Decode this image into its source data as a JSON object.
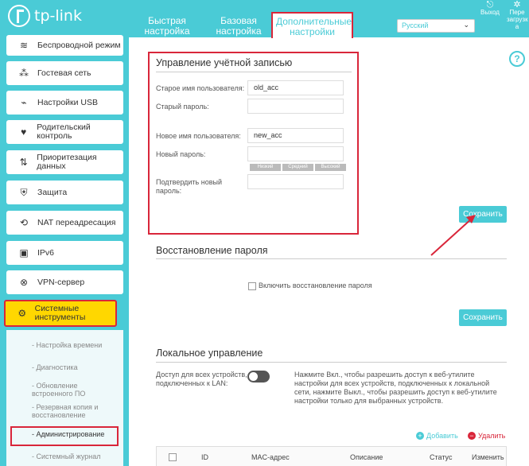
{
  "header": {
    "logo_text": "tp-link",
    "tabs": [
      {
        "label": "Быстрая настройка"
      },
      {
        "label": "Базовая настройка"
      },
      {
        "label": "Дополнительные настройки"
      }
    ],
    "language": "Русский",
    "logout_label": "Выход",
    "reboot_label": "Пере загрузк а"
  },
  "sidebar": {
    "items": [
      {
        "label": "Беспроводной режим",
        "icon": "wifi-icon"
      },
      {
        "label": "Гостевая сеть",
        "icon": "guest-network-icon"
      },
      {
        "label": "Настройки USB",
        "icon": "usb-icon"
      },
      {
        "label": "Родительский контроль",
        "icon": "heart-icon"
      },
      {
        "label": "Приоритезация данных",
        "icon": "priority-arrows-icon"
      },
      {
        "label": "Защита",
        "icon": "shield-icon"
      },
      {
        "label": "NAT переадресация",
        "icon": "nat-icon"
      },
      {
        "label": "IPv6",
        "icon": "ipv6-icon"
      },
      {
        "label": "VPN-сервер",
        "icon": "vpn-icon"
      },
      {
        "label": "Системные инструменты",
        "icon": "gear-icon"
      }
    ],
    "sub_items": [
      {
        "label": "Настройка времени"
      },
      {
        "label": "Диагностика"
      },
      {
        "label": "Обновление встроенного ПО"
      },
      {
        "label": "Резервная копия и восстановление"
      },
      {
        "label": "Администрирование"
      },
      {
        "label": "Системный журнал"
      }
    ]
  },
  "account": {
    "title": "Управление учётной записью",
    "old_username_label": "Старое имя пользователя:",
    "old_username_value": "old_acc",
    "old_password_label": "Старый пароль:",
    "new_username_label": "Новое имя пользователя:",
    "new_username_value": "new_acc",
    "new_password_label": "Новый пароль:",
    "strength": [
      "Низкий",
      "Средний",
      "Высокий"
    ],
    "confirm_password_label": "Подтвердить новый пароль:",
    "save_label": "Сохранить"
  },
  "recovery": {
    "title": "Восстановление пароля",
    "enable_label": "Включить восстановление пароля",
    "save_label": "Сохранить"
  },
  "local": {
    "title": "Локальное управление",
    "access_label": "Доступ для всех устройств, подключенных к LAN:",
    "description": "Нажмите Вкл., чтобы разрешить доступ к веб-утилите настройки для всех устройств, подключенных к локальной сети, нажмите Выкл., чтобы разрешить доступ к веб-утилите настройки только для выбранных устройств.",
    "add_label": "Добавить",
    "delete_label": "Удалить",
    "columns": [
      "ID",
      "MAC-адрес",
      "Описание",
      "Статус",
      "Изменить"
    ]
  },
  "colors": {
    "accent": "#4acbd6",
    "highlight": "#d9263a",
    "active_menu": "#ffd700"
  }
}
